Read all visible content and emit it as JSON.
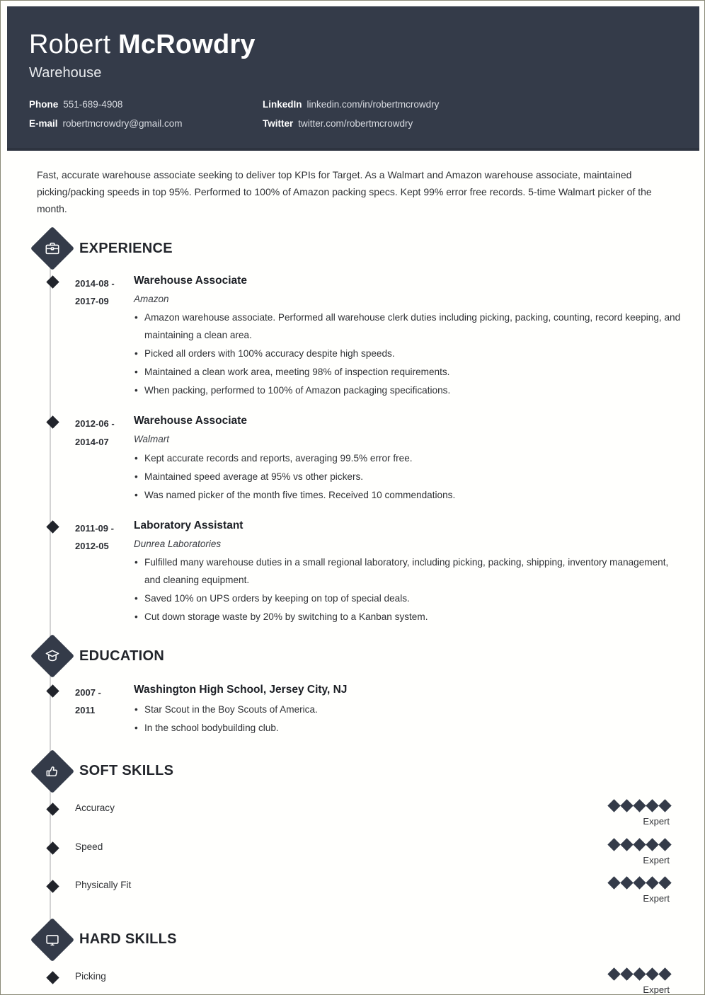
{
  "header": {
    "first_name": "Robert",
    "last_name": "McRowdry",
    "job_title": "Warehouse",
    "contacts": [
      {
        "label": "Phone",
        "value": "551-689-4908"
      },
      {
        "label": "LinkedIn",
        "value": "linkedin.com/in/robertmcrowdry"
      },
      {
        "label": "E-mail",
        "value": "robertmcrowdry@gmail.com"
      },
      {
        "label": "Twitter",
        "value": "twitter.com/robertmcrowdry"
      }
    ]
  },
  "summary": "Fast, accurate warehouse associate seeking to deliver top KPIs for Target. As a Walmart and Amazon warehouse associate, maintained picking/packing speeds in top 95%. Performed to 100% of Amazon packing specs. Kept 99% error free records. 5-time Walmart picker of the month.",
  "sections": {
    "experience": {
      "title": "EXPERIENCE",
      "icon": "briefcase-icon",
      "entries": [
        {
          "date_start": "2014-08 -",
          "date_end": "2017-09",
          "title": "Warehouse Associate",
          "subtitle": "Amazon",
          "points": [
            "Amazon warehouse associate. Performed all warehouse clerk duties including picking, packing, counting, record keeping, and maintaining a clean area.",
            "Picked all orders with 100% accuracy despite high speeds.",
            "Maintained a clean work area, meeting 98% of inspection requirements.",
            "When packing, performed to 100% of Amazon packaging specifications."
          ]
        },
        {
          "date_start": "2012-06 -",
          "date_end": "2014-07",
          "title": "Warehouse Associate",
          "subtitle": "Walmart",
          "points": [
            "Kept accurate records and reports, averaging 99.5% error free.",
            "Maintained speed average at 95% vs other pickers.",
            "Was named picker of the month five times. Received 10 commendations."
          ]
        },
        {
          "date_start": "2011-09 -",
          "date_end": "2012-05",
          "title": "Laboratory Assistant",
          "subtitle": "Dunrea Laboratories",
          "points": [
            "Fulfilled many warehouse duties in a small regional laboratory, including picking, packing, shipping, inventory management, and cleaning equipment.",
            "Saved 10% on UPS orders by keeping on top of special deals.",
            "Cut down storage waste by 20% by switching to a Kanban system."
          ]
        }
      ]
    },
    "education": {
      "title": "EDUCATION",
      "icon": "graduation-cap-icon",
      "entries": [
        {
          "date_start": "2007 -",
          "date_end": "2011",
          "title": "Washington High School, Jersey City, NJ",
          "points": [
            "Star Scout in the Boy Scouts of America.",
            "In the school bodybuilding club."
          ]
        }
      ]
    },
    "soft_skills": {
      "title": "SOFT SKILLS",
      "icon": "thumbs-up-icon",
      "skills": [
        {
          "name": "Accuracy",
          "level": 5,
          "max": 5,
          "level_label": "Expert"
        },
        {
          "name": "Speed",
          "level": 5,
          "max": 5,
          "level_label": "Expert"
        },
        {
          "name": "Physically Fit",
          "level": 5,
          "max": 5,
          "level_label": "Expert"
        }
      ]
    },
    "hard_skills": {
      "title": "HARD SKILLS",
      "icon": "monitor-icon",
      "skills": [
        {
          "name": "Picking",
          "level": 5,
          "max": 5,
          "level_label": "Expert"
        }
      ]
    }
  },
  "colors": {
    "header_bg": "#343b49",
    "accent": "#343b49",
    "text": "#2f3135",
    "rail": "#d3d3d3",
    "page_border": "#8a8a78"
  }
}
